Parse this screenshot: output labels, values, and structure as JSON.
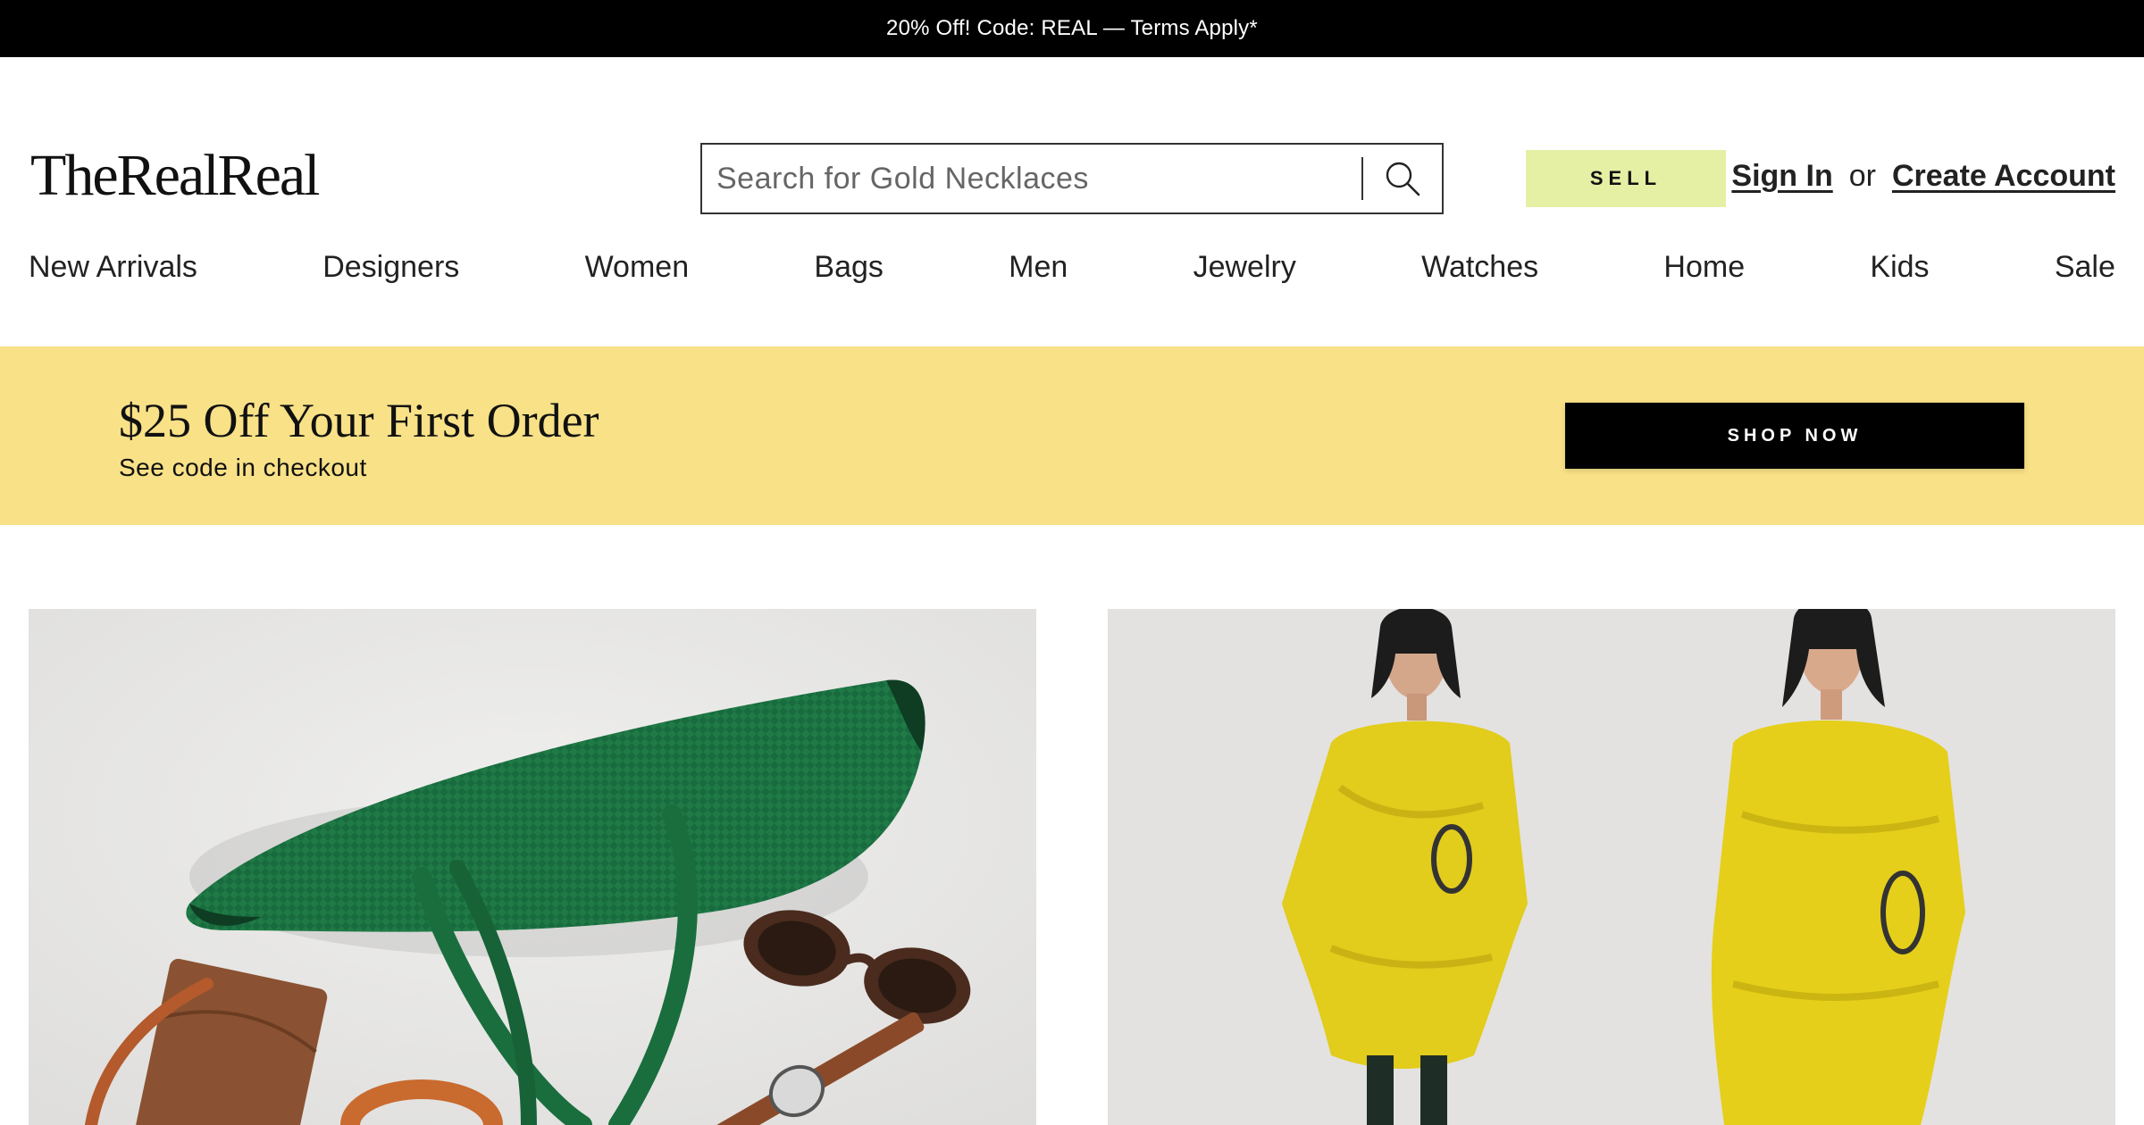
{
  "promo": {
    "text": "20% Off! Code: REAL — Terms Apply*"
  },
  "header": {
    "logo": "TheRealReal",
    "search": {
      "placeholder": "Search for Gold Necklaces",
      "icon": "search-icon"
    },
    "sell_label": "SELL",
    "sign_in": "Sign In",
    "or": "or",
    "create_account": "Create Account"
  },
  "nav": [
    "New Arrivals",
    "Designers",
    "Women",
    "Bags",
    "Men",
    "Jewelry",
    "Watches",
    "Home",
    "Kids",
    "Sale"
  ],
  "offer": {
    "title": "$25 Off Your First Order",
    "subtitle": "See code in checkout",
    "cta": "SHOP NOW",
    "bg_color": "#f8e187"
  },
  "colors": {
    "sell_bg": "#e5f0a4",
    "promo_bg": "#000000",
    "bag_green": "#1f7a45",
    "dress_yellow": "#e2cc1c"
  }
}
